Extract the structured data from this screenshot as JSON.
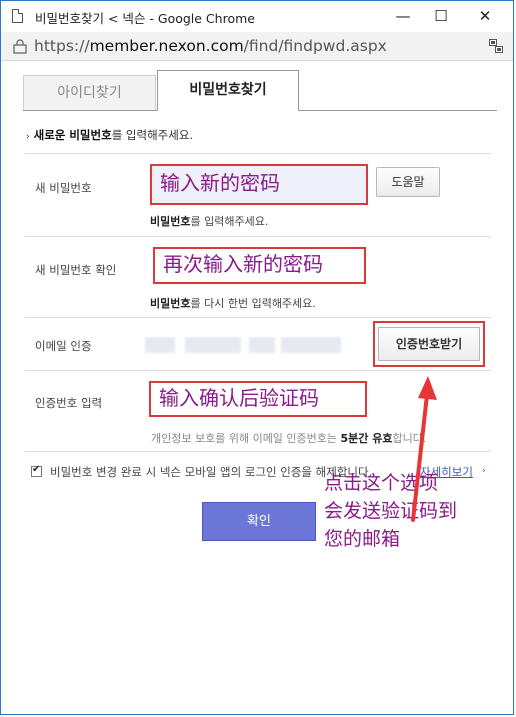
{
  "window": {
    "title": "비밀번호찾기 < 넥슨 - Google Chrome",
    "minimize_glyph": "—",
    "maximize_glyph": "☐",
    "close_glyph": "✕",
    "icons": {
      "page": "page-icon",
      "lock": "lock-icon",
      "keys": "keys-icon"
    }
  },
  "address": {
    "prefix": "https://",
    "host": "member.nexon.com",
    "path": "/find/findpwd.aspx"
  },
  "tabs": [
    {
      "label": "아이디찾기",
      "active": false
    },
    {
      "label": "비밀번호찾기",
      "active": true
    }
  ],
  "intro": {
    "arrow": "›",
    "bold": "새로운 비밀번호",
    "rest": "를 입력해주세요."
  },
  "form": {
    "new_password": {
      "label": "새 비밀번호",
      "value": "输入新的密码",
      "help_button": "도움말",
      "hint_bold": "비밀번호",
      "hint_rest": "를 입력해주세요."
    },
    "confirm_password": {
      "label": "새 비밀번호 확인",
      "value": "再次输入新的密码",
      "hint_bold": "비밀번호",
      "hint_rest": "를 다시 한번 입력해주세요."
    },
    "email": {
      "label": "이메일 인증",
      "auth_button": "인증번호받기"
    },
    "code": {
      "label": "인증번호 입력",
      "value": "输入确认后验证码",
      "hint_pre": "개인정보 보호를 위해 이메일 인증번호는 ",
      "hint_bold": "5분간 유효",
      "hint_post": "합니다."
    }
  },
  "consent": {
    "checked": true,
    "text": "비밀번호 변경 완료 시 넥슨 모바일 앱의 로그인 인증을 해제합니다.",
    "link": "자세히보기",
    "link_arrow": "›"
  },
  "confirm_button": "확인",
  "annotation": {
    "lines": [
      "点击这个选项",
      "会发送验证码到",
      "您的邮箱"
    ],
    "color": "#8b1a8b",
    "highlight_color": "#d83a3a"
  }
}
